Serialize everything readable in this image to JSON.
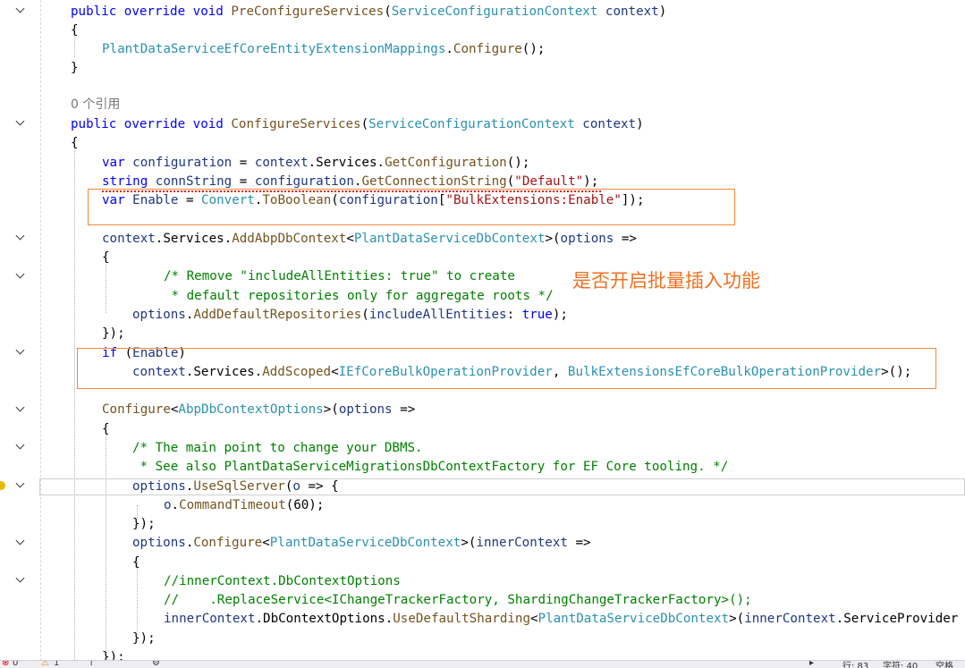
{
  "ref_count_label": "0 个引用",
  "annotation_text": "是否开启批量插入功能",
  "lines": {
    "l1": [
      "public override void ",
      "PreConfigureServices",
      "(",
      "ServiceConfigurationContext",
      " context",
      ")"
    ],
    "l2": [
      "{"
    ],
    "l3": [
      "PlantDataServiceEfCoreEntityExtensionMappings",
      ".",
      "Configure",
      "();"
    ],
    "l4": [
      "}"
    ],
    "l5": [
      "public override void ",
      "ConfigureServices",
      "(",
      "ServiceConfigurationContext",
      " context",
      ")"
    ],
    "l6": [
      "{"
    ],
    "l7": [
      "var ",
      "configuration",
      " = ",
      "context",
      ".Services.",
      "GetConfiguration",
      "();"
    ],
    "l8": [
      "string ",
      "connString",
      " = ",
      "configuration",
      ".",
      "GetConnectionString",
      "(",
      "\"Default\"",
      ");"
    ],
    "l9": [
      "var ",
      "Enable",
      " = ",
      "Convert",
      ".",
      "ToBoolean",
      "(",
      "configuration",
      "[",
      "\"BulkExtensions:Enable\"",
      "]);"
    ],
    "l10": [
      "context",
      ".Services.",
      "AddAbpDbContext",
      "<",
      "PlantDataServiceDbContext",
      ">(",
      "options",
      " =>"
    ],
    "l11": [
      "{"
    ],
    "l12": [
      "/* Remove \"includeAllEntities: true\" to create"
    ],
    "l13": [
      " * default repositories only for aggregate roots */"
    ],
    "l14": [
      "options",
      ".",
      "AddDefaultRepositories",
      "(",
      "includeAllEntities",
      ": ",
      "true",
      ");"
    ],
    "l15": [
      "});"
    ],
    "l16": [
      "if ",
      "(",
      "Enable",
      ")"
    ],
    "l17": [
      "context",
      ".Services.",
      "AddScoped",
      "<",
      "IEfCoreBulkOperationProvider",
      ", ",
      "BulkExtensionsEfCoreBulkOperationProvider",
      ">();"
    ],
    "l18": [
      "Configure",
      "<",
      "AbpDbContextOptions",
      ">(",
      "options",
      " =>"
    ],
    "l19": [
      "{"
    ],
    "l20": [
      "/* The main point to change your DBMS."
    ],
    "l21": [
      " * See also PlantDataServiceMigrationsDbContextFactory for EF Core tooling. */"
    ],
    "l22": [
      "options",
      ".",
      "UseSqlServer",
      "(",
      "o",
      " => {"
    ],
    "l23": [
      "o",
      ".",
      "CommandTimeout",
      "(60);"
    ],
    "l24": [
      "});"
    ],
    "l25": [
      "options",
      ".",
      "Configure",
      "<",
      "PlantDataServiceDbContext",
      ">(",
      "innerContext",
      " =>"
    ],
    "l26": [
      "{"
    ],
    "l27": [
      "//innerContext.DbContextOptions"
    ],
    "l28": [
      "//    .ReplaceService<IChangeTrackerFactory, ShardingChangeTrackerFactory>();"
    ],
    "l29": [
      "innerContext",
      ".DbContextOptions.",
      "UseDefaultSharding",
      "<",
      "PlantDataServiceDbContext",
      ">(",
      "innerContext",
      ".ServiceProvider"
    ],
    "l30": [
      "});"
    ],
    "l31": [
      "});"
    ]
  },
  "status": {
    "errors": "0",
    "warnings": "1",
    "row": "行: 83",
    "col": "字符: 40",
    "mode": "空格"
  },
  "colors": {
    "keyword": "#0000ff",
    "type": "#2b91af",
    "method": "#74531f",
    "variable": "#1f377f",
    "string": "#a31515",
    "comment": "#008000",
    "highlight_box": "#f0883a",
    "annotation": "#f07020"
  }
}
